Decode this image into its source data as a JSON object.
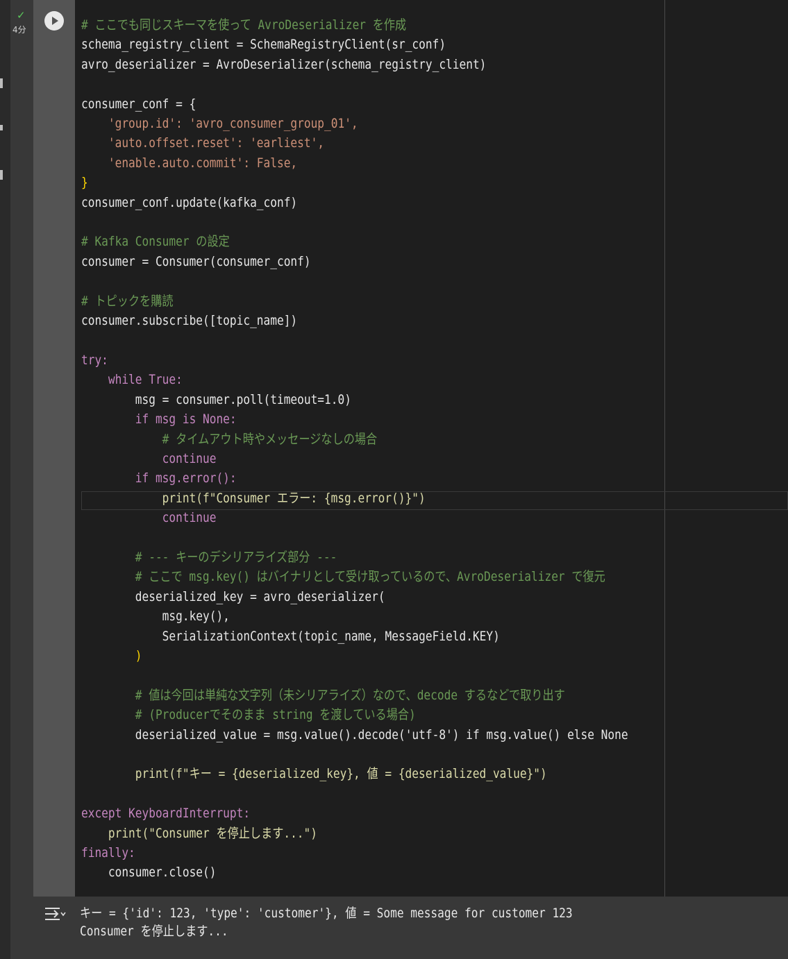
{
  "cell": {
    "status_icon": "check-icon",
    "exec_time": "4分",
    "run_button_icon": "play-icon",
    "code_lines": [
      "# ここでも同じスキーマを使って AvroDeserializer を作成",
      "schema_registry_client = SchemaRegistryClient(sr_conf)",
      "avro_deserializer = AvroDeserializer(schema_registry_client)",
      "",
      "consumer_conf = {",
      "    'group.id': 'avro_consumer_group_01',",
      "    'auto.offset.reset': 'earliest',",
      "    'enable.auto.commit': False,",
      "}",
      "consumer_conf.update(kafka_conf)",
      "",
      "# Kafka Consumer の設定",
      "consumer = Consumer(consumer_conf)",
      "",
      "# トピックを購読",
      "consumer.subscribe([topic_name])",
      "",
      "try:",
      "    while True:",
      "        msg = consumer.poll(timeout=1.0)",
      "        if msg is None:",
      "            # タイムアウト時やメッセージなしの場合",
      "            continue",
      "        if msg.error():",
      "            print(f\"Consumer エラー: {msg.error()}\")",
      "            continue",
      "",
      "        # --- キーのデシリアライズ部分 ---",
      "        # ここで msg.key() はバイナリとして受け取っているので、AvroDeserializer で復元",
      "        deserialized_key = avro_deserializer(",
      "            msg.key(),",
      "            SerializationContext(topic_name, MessageField.KEY)",
      "        )",
      "",
      "        # 値は今回は単純な文字列（未シリアライズ）なので、decode するなどで取り出す",
      "        # (Producerでそのまま string を渡している場合)",
      "        deserialized_value = msg.value().decode('utf-8') if msg.value() else None",
      "",
      "        print(f\"キー = {deserialized_key}, 値 = {deserialized_value}\")",
      "",
      "except KeyboardInterrupt:",
      "    print(\"Consumer を停止します...\")",
      "finally:",
      "    consumer.close()"
    ]
  },
  "output": {
    "icon": "output-toggle-icon",
    "lines": [
      "キー = {'id': 123, 'type': 'customer'}, 値 = Some message for customer 123",
      "Consumer を停止します..."
    ]
  }
}
